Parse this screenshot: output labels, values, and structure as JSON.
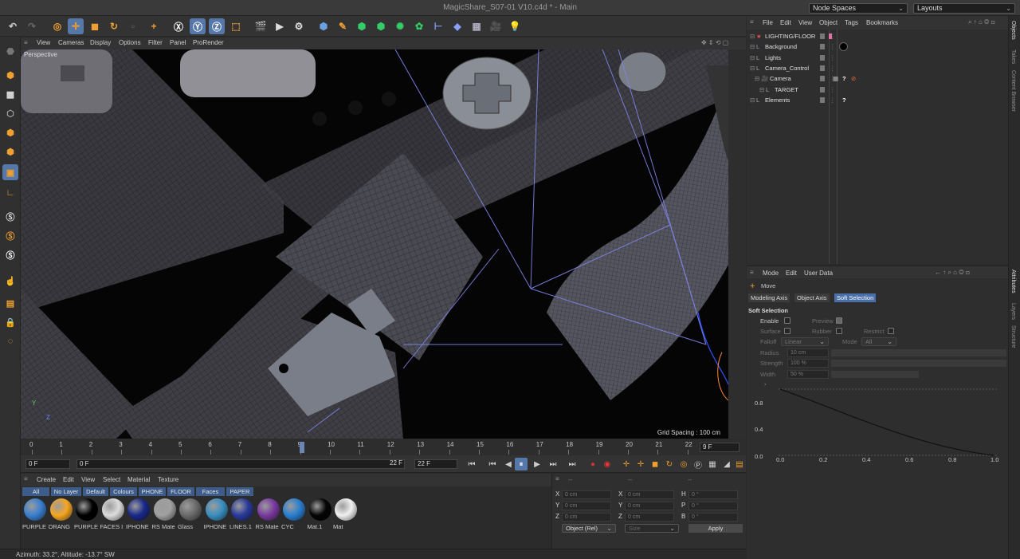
{
  "window": {
    "title": "MagicShare_S07-01 V10.c4d * - Main",
    "node_spaces": "Node Spaces",
    "layouts": "Layouts"
  },
  "viewport": {
    "menu": [
      "View",
      "Cameras",
      "Display",
      "Options",
      "Filter",
      "Panel",
      "ProRender"
    ],
    "label": "Perspective",
    "grid_spacing": "Grid Spacing : 100 cm"
  },
  "timeline": {
    "ticks": [
      "0",
      "1",
      "2",
      "3",
      "4",
      "5",
      "6",
      "7",
      "8",
      "9",
      "10",
      "11",
      "12",
      "13",
      "14",
      "15",
      "16",
      "17",
      "18",
      "19",
      "20",
      "21",
      "22"
    ],
    "current_frame": "9 F"
  },
  "transport": {
    "start": "0 F",
    "min": "0 F",
    "max": "22 F",
    "end": "22 F"
  },
  "material_manager": {
    "menu": [
      "Create",
      "Edit",
      "View",
      "Select",
      "Material",
      "Texture"
    ],
    "tabs": [
      "All",
      "No Layer",
      "Default",
      "Colours",
      "PHONE",
      "FLOOR",
      "Faces",
      "PAPER"
    ],
    "materials": [
      {
        "name": "PURPLE",
        "color": "#3a7fd0"
      },
      {
        "name": "ORANG",
        "color": "#f5a623"
      },
      {
        "name": "PURPLE",
        "color": "#000000"
      },
      {
        "name": "FACES I",
        "color": "#dcdcdc"
      },
      {
        "name": "IPHONE",
        "color": "#1a2a8a"
      },
      {
        "name": "RS Mate",
        "color": "#a0a0a0"
      },
      {
        "name": "Glass",
        "color": "#6a6a6a"
      },
      {
        "name": "IPHONE",
        "color": "#3a8fc0"
      },
      {
        "name": "LINES.1",
        "color": "#2a3a9a"
      },
      {
        "name": "RS Mate",
        "color": "#7a3aa0"
      },
      {
        "name": "CYC",
        "color": "#2a7fd0"
      },
      {
        "name": "Mat.1",
        "color": "#050505"
      },
      {
        "name": "Mat",
        "color": "#f0f0f0"
      }
    ]
  },
  "coordinates": {
    "header": [
      "--",
      "--",
      "--"
    ],
    "rows": [
      {
        "a": "X",
        "a_val": "0 cm",
        "b": "X",
        "b_val": "0 cm",
        "c": "H",
        "c_val": "0 °"
      },
      {
        "a": "Y",
        "a_val": "0 cm",
        "b": "Y",
        "b_val": "0 cm",
        "c": "P",
        "c_val": "0 °"
      },
      {
        "a": "Z",
        "a_val": "0 cm",
        "b": "Z",
        "b_val": "0 cm",
        "c": "B",
        "c_val": "0 °"
      }
    ],
    "mode": "Object (Rel)",
    "size": "Size",
    "apply": "Apply"
  },
  "status": "Azimuth: 33.2°, Altitude: -13.7°  SW",
  "object_manager": {
    "menu": [
      "File",
      "Edit",
      "View",
      "Object",
      "Tags",
      "Bookmarks"
    ],
    "objects": [
      {
        "name": "LIGHTING/FLOOR",
        "indent": 0
      },
      {
        "name": "Background",
        "indent": 0
      },
      {
        "name": "Lights",
        "indent": 0
      },
      {
        "name": "Camera_Control",
        "indent": 0
      },
      {
        "name": "Camera",
        "indent": 1
      },
      {
        "name": "TARGET",
        "indent": 2
      },
      {
        "name": "Elements",
        "indent": 0
      }
    ]
  },
  "attributes": {
    "menu": [
      "Mode",
      "Edit",
      "User Data"
    ],
    "tool": "Move",
    "tabs": [
      "Modeling Axis",
      "Object Axis",
      "Soft Selection"
    ],
    "section": "Soft Selection",
    "enable": "Enable",
    "preview": "Preview",
    "surface": "Surface",
    "rubber": "Rubber",
    "restrict": "Restrict",
    "falloff": "Falloff",
    "falloff_value": "Linear",
    "mode": "Mode",
    "mode_value": "All",
    "radius": "Radius",
    "radius_value": "10 cm",
    "strength": "Strength",
    "strength_value": "100 %",
    "width": "Width",
    "width_value": "50 %",
    "graph_x": [
      "0.0",
      "0.2",
      "0.4",
      "0.6",
      "0.8",
      "1.0"
    ],
    "graph_y": [
      "0.8",
      "0.4",
      "0.0"
    ]
  },
  "side_tabs": [
    "Objects",
    "Takes",
    "Content Browser",
    "Attributes",
    "Layers",
    "Structure"
  ]
}
